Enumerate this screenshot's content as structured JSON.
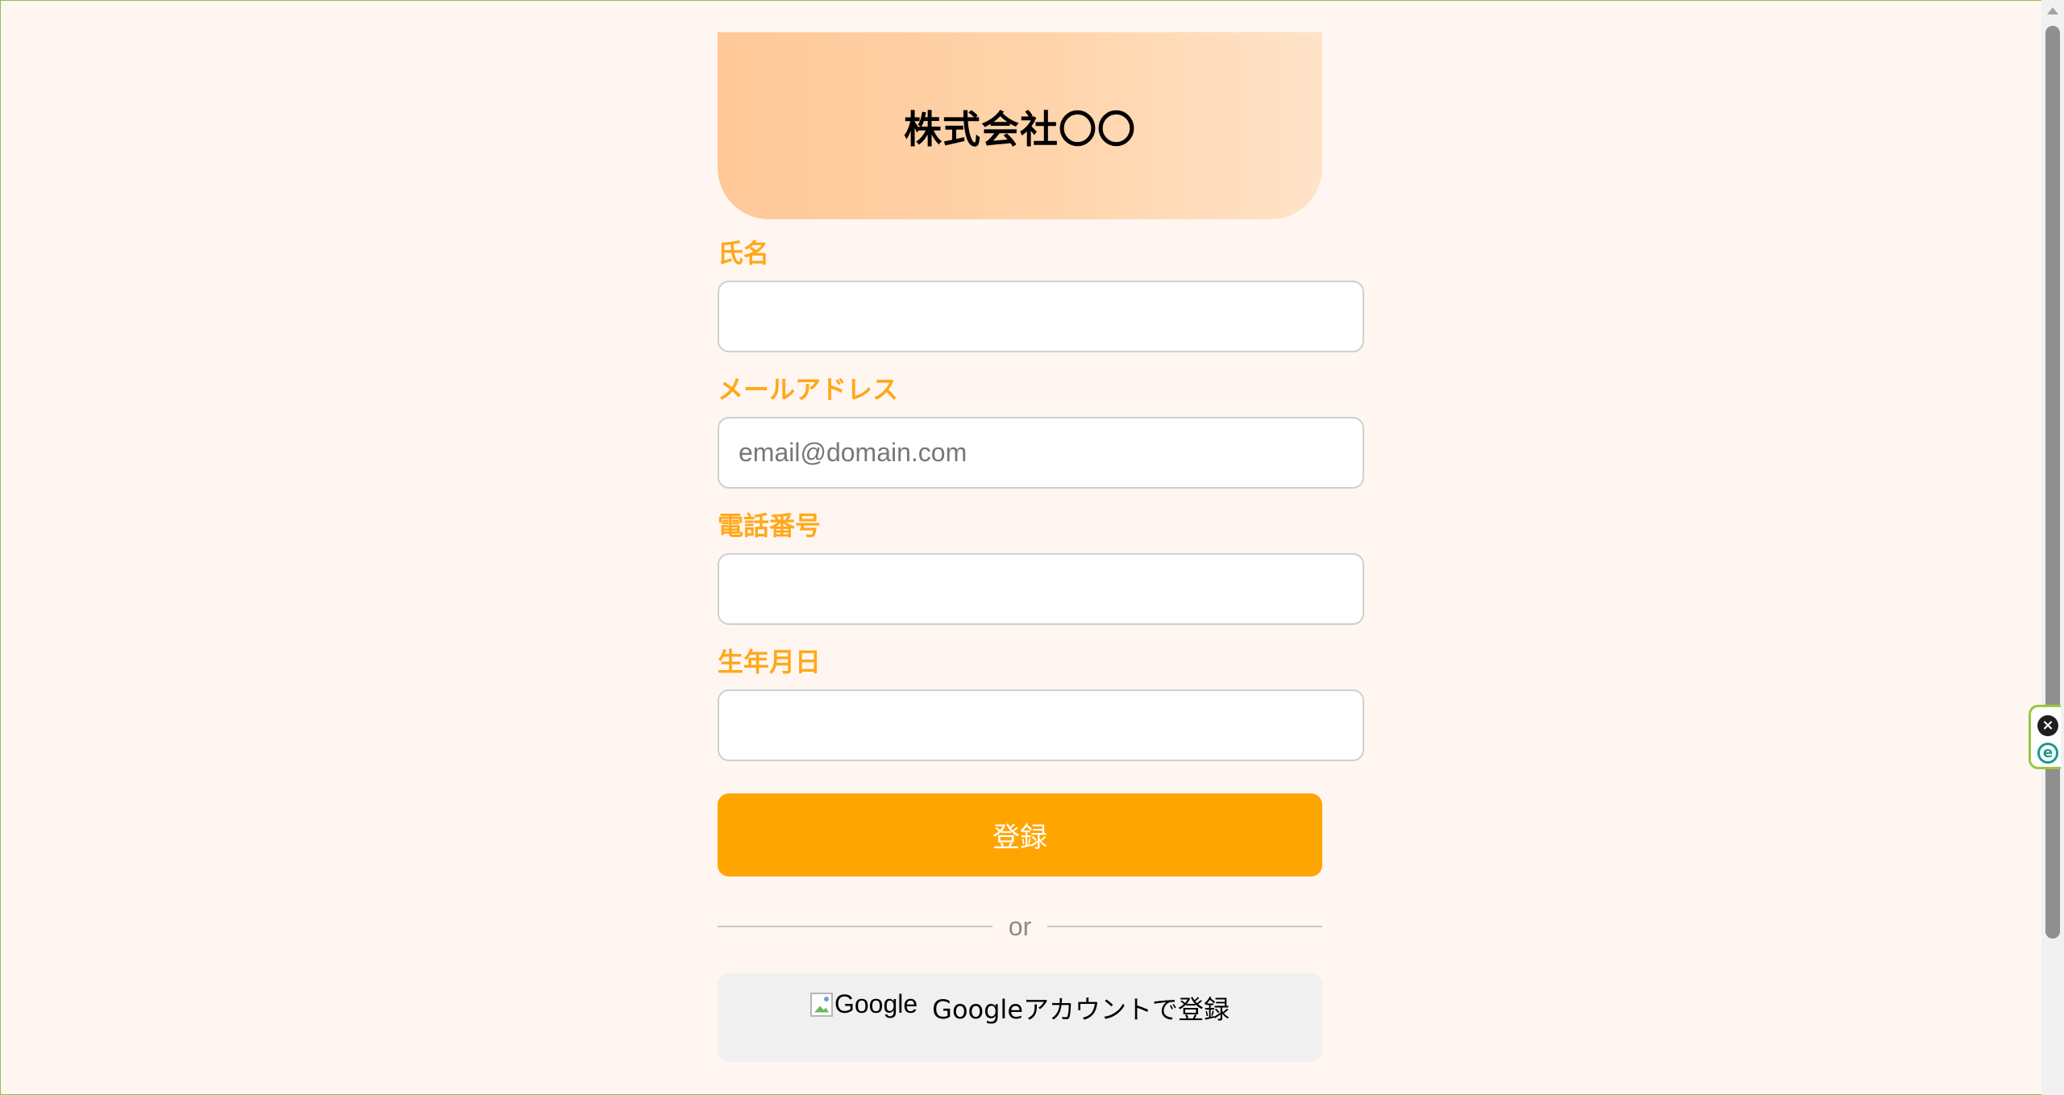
{
  "header": {
    "company_name": "株式会社〇〇"
  },
  "form": {
    "name_label": "氏名",
    "name_value": "",
    "email_label": "メールアドレス",
    "email_placeholder": "email@domain.com",
    "email_value": "",
    "phone_label": "電話番号",
    "phone_value": "",
    "birthdate_label": "生年月日",
    "birthdate_value": "",
    "submit_label": "登録"
  },
  "divider": {
    "text": "or"
  },
  "google": {
    "logo_alt": "Google",
    "button_label": "Googleアカウントで登録"
  },
  "side_widget": {
    "close_icon": "close-icon",
    "extension_icon": "e-icon"
  },
  "colors": {
    "accent": "#ffa500",
    "label": "#ffa81a",
    "background": "#fff6f1",
    "banner_start": "#ffc898",
    "banner_end": "#ffe3c8"
  }
}
